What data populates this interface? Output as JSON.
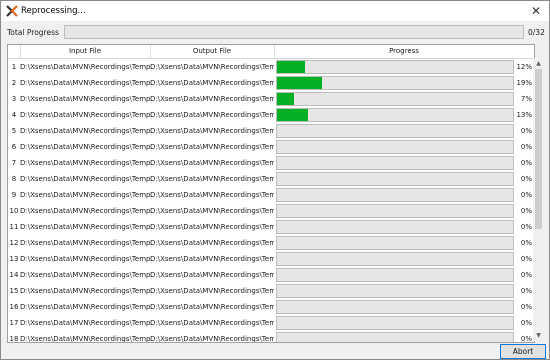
{
  "window": {
    "title": "Reprocessing...",
    "close_glyph": "✕"
  },
  "total": {
    "label": "Total Progress",
    "fraction": 0.0,
    "count": "0/32"
  },
  "table": {
    "headers": {
      "input": "Input File",
      "output": "Output File",
      "progress": "Progress"
    },
    "rows": [
      {
        "num": "1",
        "input": "D:\\Xsens\\Data\\MVN\\Recordings\\Temp\\DyD",
        "output": "D:\\Xsens\\Data\\MVN\\Recordings\\Temp\\HC",
        "percent": "12%",
        "fraction": 0.12
      },
      {
        "num": "2",
        "input": "D:\\Xsens\\Data\\MVN\\Recordings\\Temp\\DyD",
        "output": "D:\\Xsens\\Data\\MVN\\Recordings\\Temp\\HC",
        "percent": "19%",
        "fraction": 0.19
      },
      {
        "num": "3",
        "input": "D:\\Xsens\\Data\\MVN\\Recordings\\Temp\\DyD",
        "output": "D:\\Xsens\\Data\\MVN\\Recordings\\Temp\\HC",
        "percent": "7%",
        "fraction": 0.07
      },
      {
        "num": "4",
        "input": "D:\\Xsens\\Data\\MVN\\Recordings\\Temp\\Pa",
        "output": "D:\\Xsens\\Data\\MVN\\Recordings\\Temp\\HC",
        "percent": "13%",
        "fraction": 0.13
      },
      {
        "num": "5",
        "input": "D:\\Xsens\\Data\\MVN\\Recordings\\Temp\\TaD",
        "output": "D:\\Xsens\\Data\\MVN\\Recordings\\Temp\\HC",
        "percent": "0%",
        "fraction": 0
      },
      {
        "num": "6",
        "input": "D:\\Xsens\\Data\\MVN\\Recordings\\Temp\\TaD",
        "output": "D:\\Xsens\\Data\\MVN\\Recordings\\Temp\\HC",
        "percent": "0%",
        "fraction": 0
      },
      {
        "num": "7",
        "input": "D:\\Xsens\\Data\\MVN\\Recordings\\Temp\\TaD",
        "output": "D:\\Xsens\\Data\\MVN\\Recordings\\Temp\\HC",
        "percent": "0%",
        "fraction": 0
      },
      {
        "num": "8",
        "input": "D:\\Xsens\\Data\\MVN\\Recordings\\Temp\\TaD",
        "output": "D:\\Xsens\\Data\\MVN\\Recordings\\Temp\\HC",
        "percent": "0%",
        "fraction": 0
      },
      {
        "num": "9",
        "input": "D:\\Xsens\\Data\\MVN\\Recordings\\Temp\\VRD",
        "output": "D:\\Xsens\\Data\\MVN\\Recordings\\Temp\\HC",
        "percent": "0%",
        "fraction": 0
      },
      {
        "num": "10",
        "input": "D:\\Xsens\\Data\\MVN\\Recordings\\Temp\\VRD",
        "output": "D:\\Xsens\\Data\\MVN\\Recordings\\Temp\\HC",
        "percent": "0%",
        "fraction": 0
      },
      {
        "num": "11",
        "input": "D:\\Xsens\\Data\\MVN\\Recordings\\Temp\\VRD",
        "output": "D:\\Xsens\\Data\\MVN\\Recordings\\Temp\\HC",
        "percent": "0%",
        "fraction": 0
      },
      {
        "num": "12",
        "input": "D:\\Xsens\\Data\\MVN\\Recordings\\Temp\\VRD",
        "output": "D:\\Xsens\\Data\\MVN\\Recordings\\Temp\\HC",
        "percent": "0%",
        "fraction": 0
      },
      {
        "num": "13",
        "input": "D:\\Xsens\\Data\\MVN\\Recordings\\Temp\\VRD",
        "output": "D:\\Xsens\\Data\\MVN\\Recordings\\Temp\\HC",
        "percent": "0%",
        "fraction": 0
      },
      {
        "num": "14",
        "input": "D:\\Xsens\\Data\\MVN\\Recordings\\Temp\\VRD",
        "output": "D:\\Xsens\\Data\\MVN\\Recordings\\Temp\\HC",
        "percent": "0%",
        "fraction": 0
      },
      {
        "num": "15",
        "input": "D:\\Xsens\\Data\\MVN\\Recordings\\Temp\\VRD",
        "output": "D:\\Xsens\\Data\\MVN\\Recordings\\Temp\\HC",
        "percent": "0%",
        "fraction": 0
      },
      {
        "num": "16",
        "input": "D:\\Xsens\\Data\\MVN\\Recordings\\Temp\\VuD",
        "output": "D:\\Xsens\\Data\\MVN\\Recordings\\Temp\\HC",
        "percent": "0%",
        "fraction": 0
      },
      {
        "num": "17",
        "input": "D:\\Xsens\\Data\\MVN\\Recordings\\Temp\\VuD",
        "output": "D:\\Xsens\\Data\\MVN\\Recordings\\Temp\\HC",
        "percent": "0%",
        "fraction": 0
      },
      {
        "num": "18",
        "input": "D:\\Xsens\\Data\\MVN\\Recordings\\Temp\\VuD",
        "output": "D:\\Xsens\\Data\\MVN\\Recordings\\Temp\\HC",
        "percent": "0%",
        "fraction": 0
      }
    ]
  },
  "buttons": {
    "abort": "Abort"
  },
  "colors": {
    "progress_fill": "#06b025",
    "app_icon_orange": "#e8641e",
    "app_icon_dark": "#333333"
  }
}
